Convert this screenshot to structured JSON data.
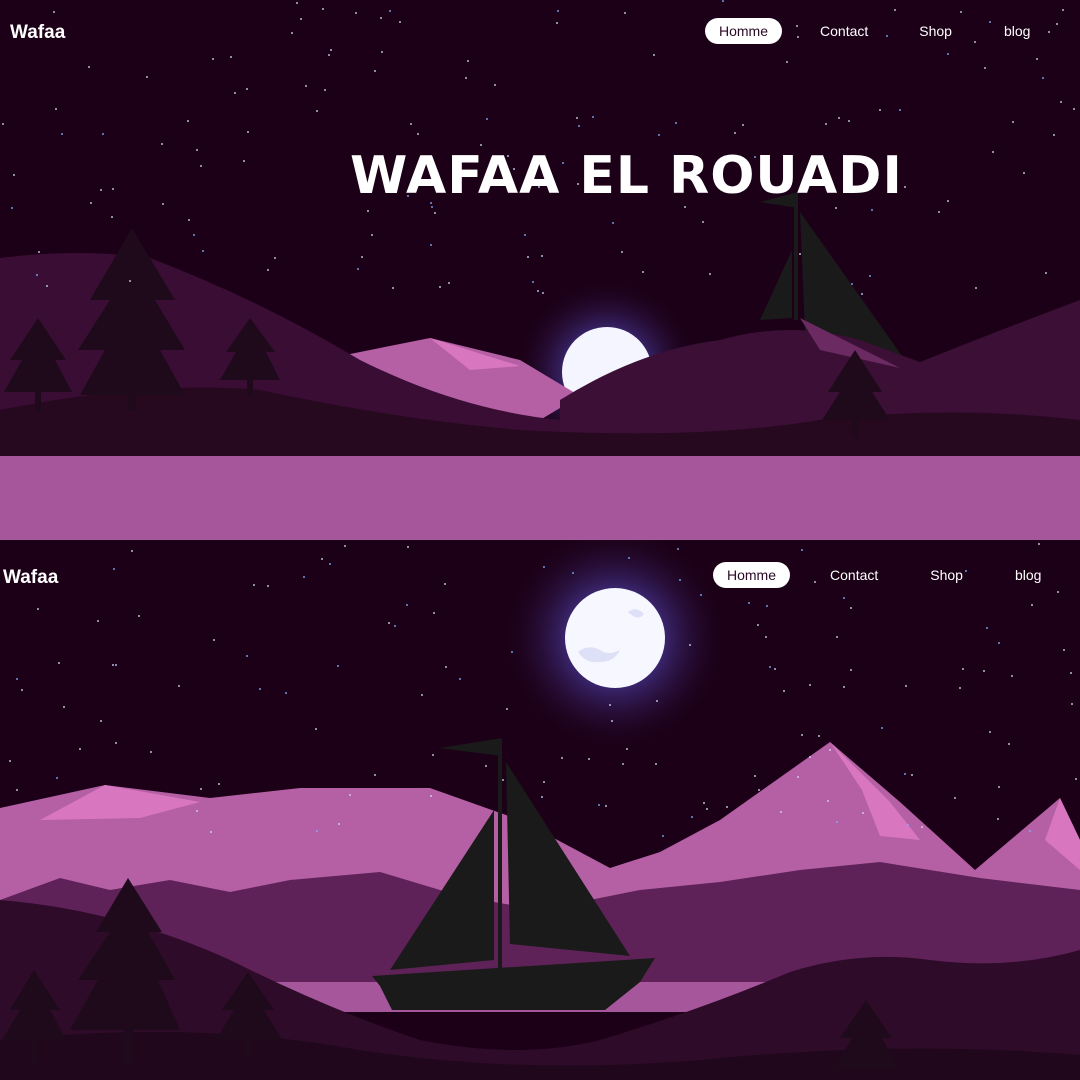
{
  "screen_top": {
    "brand": "Wafaa",
    "nav": [
      {
        "label": "Homme",
        "active": true
      },
      {
        "label": "Contact",
        "active": false
      },
      {
        "label": "Shop",
        "active": false
      },
      {
        "label": "blog",
        "active": false
      }
    ],
    "hero_title": "WAFAA EL ROUADI"
  },
  "screen_bottom": {
    "brand": "Wafaa",
    "nav": [
      {
        "label": "Homme",
        "active": true
      },
      {
        "label": "Contact",
        "active": false
      },
      {
        "label": "Shop",
        "active": false
      },
      {
        "label": "blog",
        "active": false
      }
    ]
  },
  "colors": {
    "sky": "#1c0017",
    "band": "#a6579c",
    "mountain_light": "#b55fa5",
    "mountain_highlight": "#d877c0",
    "mountain_dark": "#5e2258",
    "foreground_dark": "#2a0a26",
    "silhouette": "#1a1a1a",
    "moon_glow": "#7f7df0"
  }
}
